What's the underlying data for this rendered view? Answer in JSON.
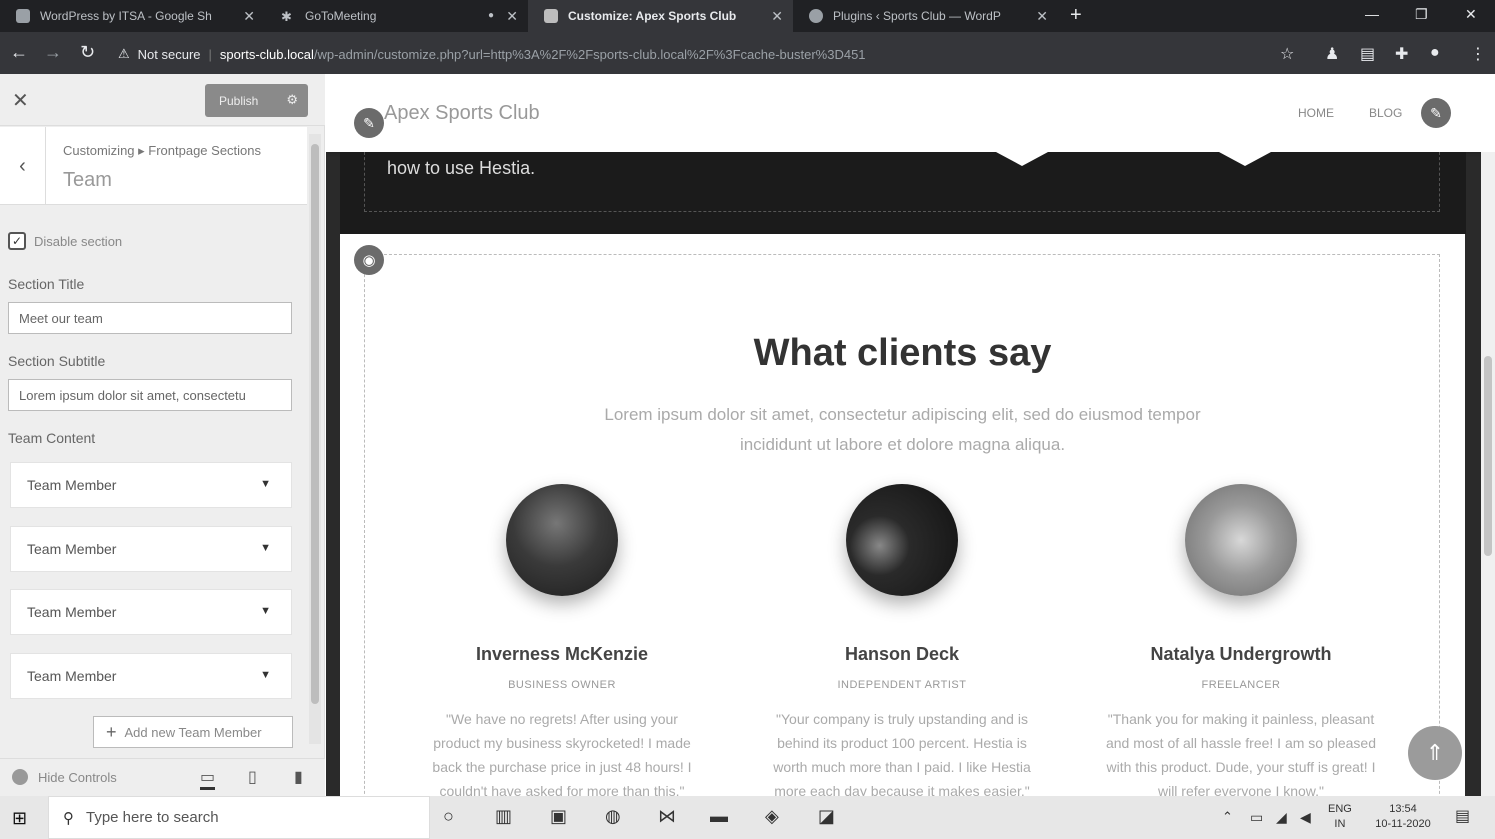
{
  "browser": {
    "tabs": [
      {
        "title": "WordPress by ITSA - Google Sh"
      },
      {
        "title": "GoToMeeting"
      },
      {
        "title": "Customize: Apex Sports Club"
      },
      {
        "title": "Plugins ‹ Sports Club — WordP"
      }
    ],
    "security": "Not secure",
    "url_host": "sports-club.local",
    "url_path": "/wp-admin/customize.php?url=http%3A%2F%2Fsports-club.local%2F%3Fcache-buster%3D451"
  },
  "customizer": {
    "publish_label": "Publish",
    "breadcrumb": "Customizing ▸ Frontpage Sections",
    "section_title": "Team",
    "disable_label": "Disable section",
    "section_title_label": "Section Title",
    "section_title_value": "Meet our team",
    "section_subtitle_label": "Section Subtitle",
    "section_subtitle_value": "Lorem ipsum dolor sit amet, consectetu",
    "team_content_label": "Team Content",
    "members": [
      "Team Member",
      "Team Member",
      "Team Member",
      "Team Member"
    ],
    "add_member_label": "Add new Team Member",
    "hide_controls_label": "Hide Controls"
  },
  "preview": {
    "logo": "Apex Sports Club",
    "nav": [
      "HOME",
      "BLOG"
    ],
    "band_text": "how to use Hestia.",
    "title": "What clients say",
    "subtitle": "Lorem ipsum dolor sit amet, consectetur adipiscing elit, sed do eiusmod tempor incididunt ut labore et dolore magna aliqua.",
    "testimonials": [
      {
        "name": "Inverness McKenzie",
        "role": "BUSINESS OWNER",
        "quote": "\"We have no regrets! After using your product my business skyrocketed! I made back the purchase price in just 48 hours! I couldn't have asked for more than this.\""
      },
      {
        "name": "Hanson Deck",
        "role": "INDEPENDENT ARTIST",
        "quote": "\"Your company is truly upstanding and is behind its product 100 percent. Hestia is worth much more than I paid. I like Hestia more each day because it makes easier.\""
      },
      {
        "name": "Natalya Undergrowth",
        "role": "FREELANCER",
        "quote": "\"Thank you for making it painless, pleasant and most of all hassle free! I am so pleased with this product. Dude, your stuff is great! I will refer everyone I know.\""
      }
    ]
  },
  "taskbar": {
    "search_placeholder": "Type here to search",
    "lang": "ENG",
    "lang_sub": "IN",
    "time": "13:54",
    "date": "10-11-2020"
  }
}
